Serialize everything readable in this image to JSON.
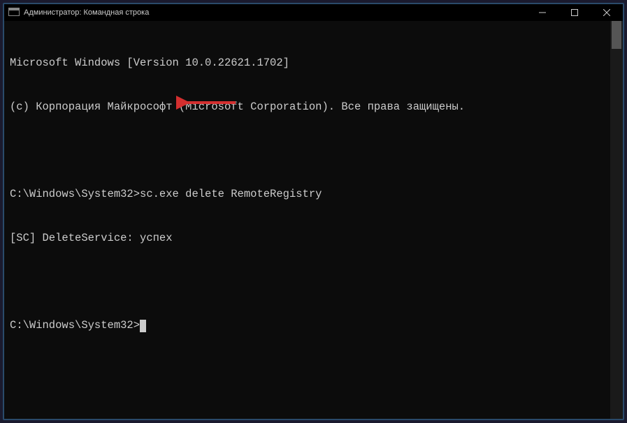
{
  "window": {
    "title": "Администратор: Командная строка"
  },
  "terminal": {
    "line1": "Microsoft Windows [Version 10.0.22621.1702]",
    "line2": "(c) Корпорация Майкрософт (Microsoft Corporation). Все права защищены.",
    "blank1": "",
    "prompt1_prefix": "C:\\Windows\\System32>",
    "prompt1_command": "sc.exe delete RemoteRegistry",
    "result": "[SC] DeleteService: успех",
    "blank2": "",
    "prompt2_prefix": "C:\\Windows\\System32>"
  },
  "annotation": {
    "arrow_color": "#d32f2f"
  }
}
